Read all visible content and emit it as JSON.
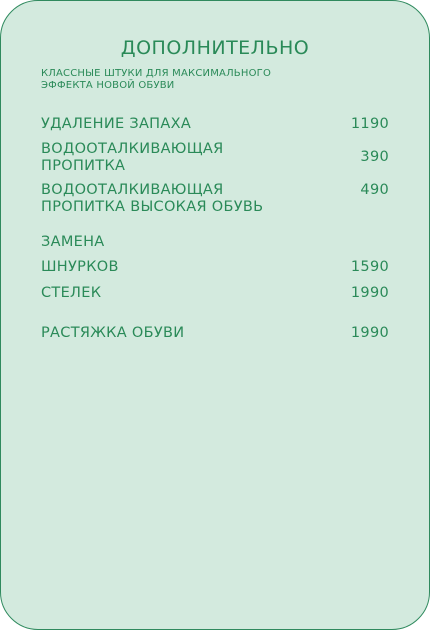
{
  "header": {
    "title": "ДОПОЛНИТЕЛЬНО",
    "subtitle_line1": "КЛАССНЫЕ ШТУКИ ДЛЯ МАКСИМАЛЬНОГО",
    "subtitle_line2": "ЭФФЕКТА НОВОЙ ОБУВИ"
  },
  "items": [
    {
      "label": "УДАЛЕНИЕ ЗАПАХА",
      "price": "1190"
    },
    {
      "label_line1": "ВОДООТАЛКИВАЮЩАЯ",
      "label_line2": "ПРОПИТКА",
      "price": "390"
    },
    {
      "label_line1": "ВОДООТАЛКИВАЮЩАЯ",
      "label_line2": "ПРОПИТКА ВЫСОКАЯ ОБУВЬ",
      "price": "490"
    }
  ],
  "replacement": {
    "heading": "ЗАМЕНА",
    "items": [
      {
        "label": "ШНУРКОВ",
        "price": "1590"
      },
      {
        "label": "СТЕЛЕК",
        "price": "1990"
      }
    ]
  },
  "stretch": {
    "label": "РАСТЯЖКА ОБУВИ",
    "price": "1990"
  },
  "colors": {
    "background": "#d3eade",
    "text": "#2a8a58",
    "border": "#2f8a5e"
  }
}
